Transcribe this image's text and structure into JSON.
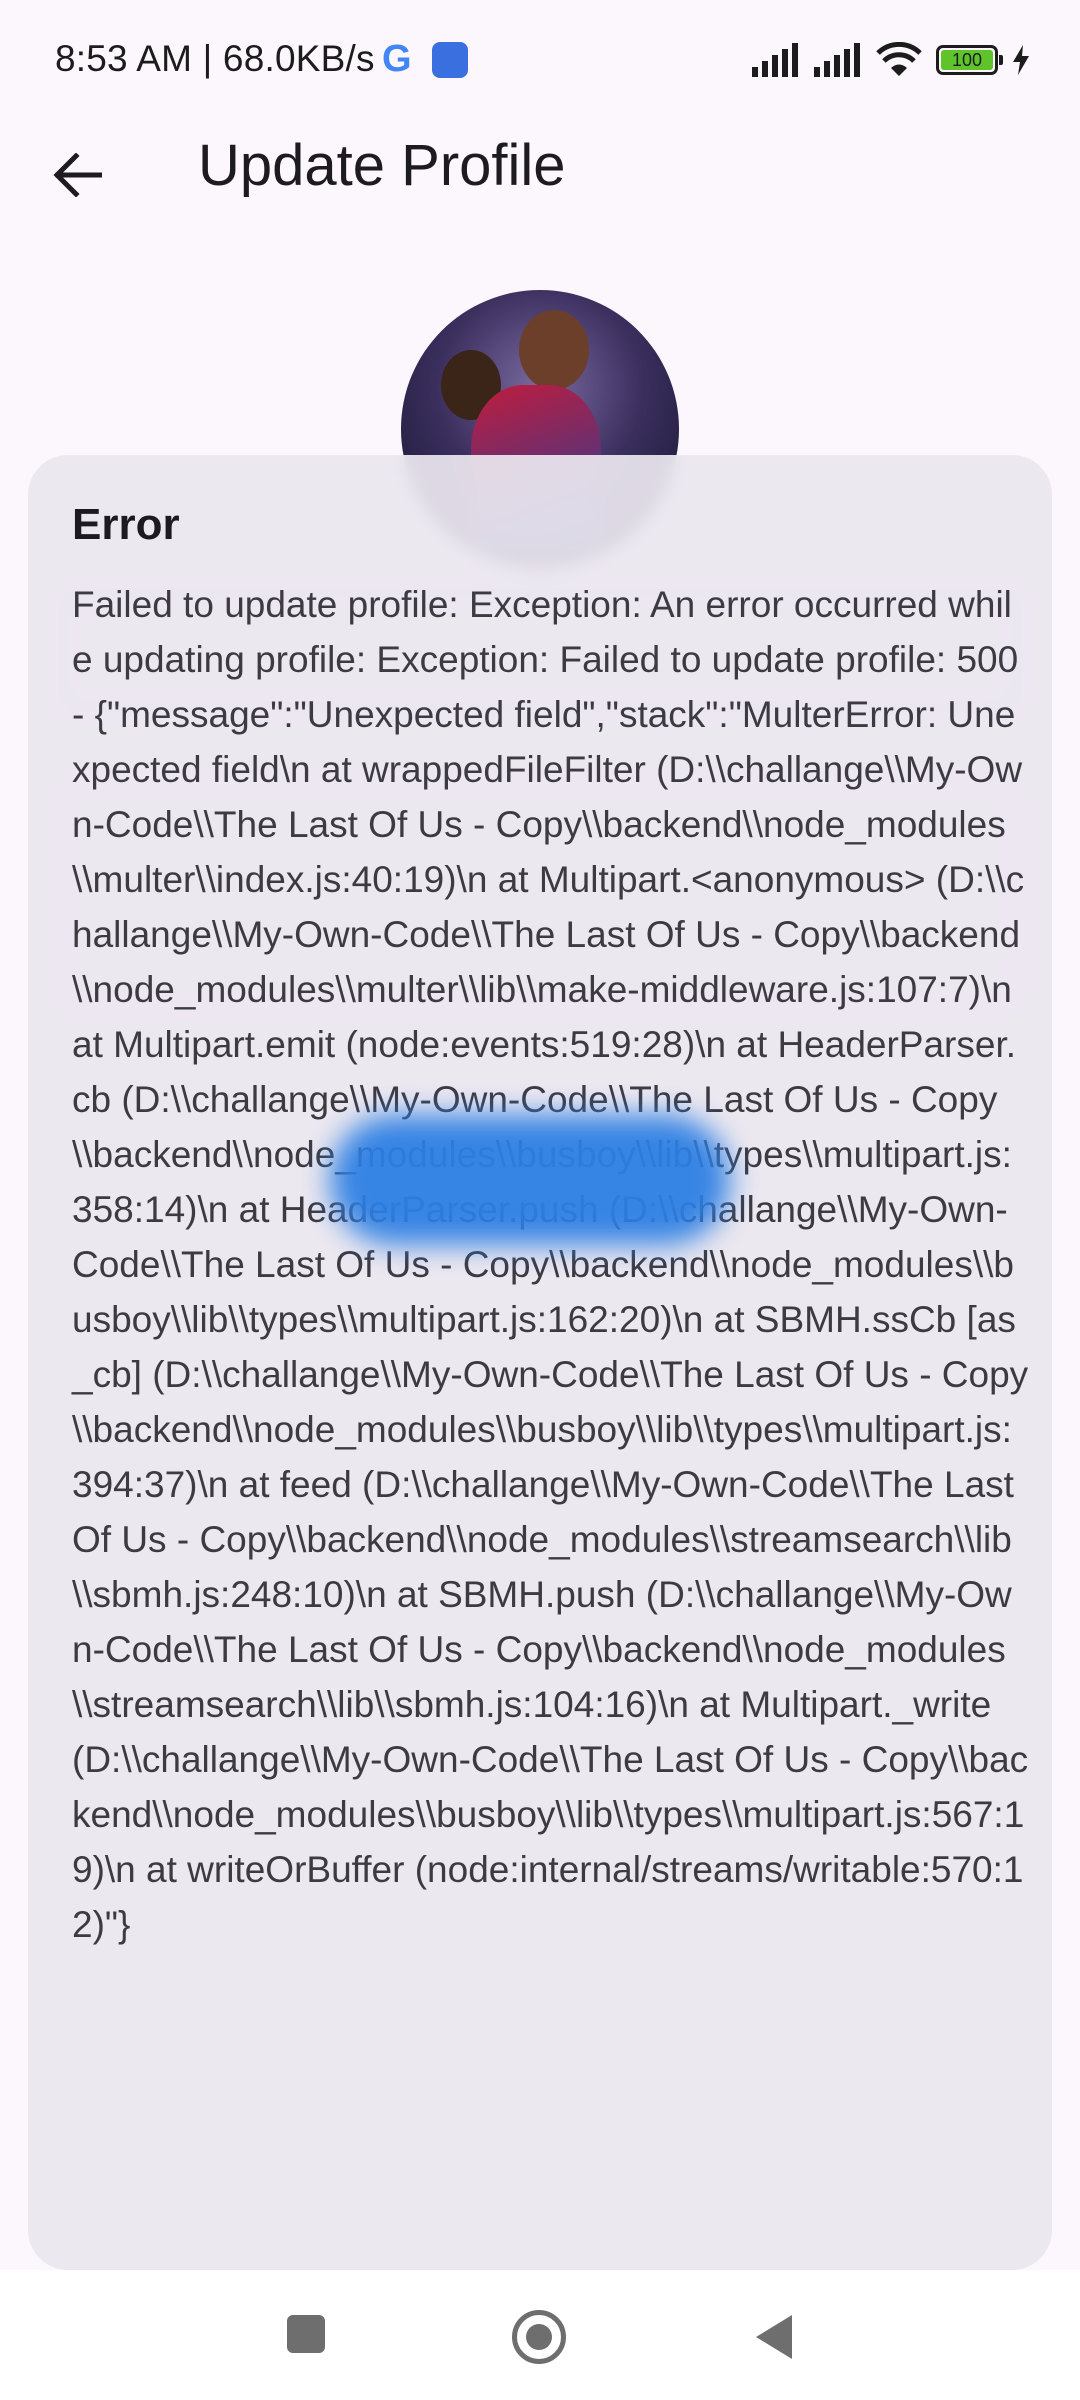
{
  "status_bar": {
    "time_speed": "8:53 AM | 68.0KB/s",
    "google_glyph": "G",
    "battery_level": "100",
    "icons": [
      "google-icon",
      "app-notification-icon",
      "signal-icon",
      "signal-icon",
      "wifi-icon",
      "battery-icon",
      "charging-icon"
    ]
  },
  "app_bar": {
    "title": "Update Profile",
    "back_icon": "arrow-left-icon"
  },
  "dialog": {
    "title": "Error",
    "message": "Failed to update profile: Exception: An error occurred while updating profile: Exception: Failed to update profile: 500 - {\"message\":\"Unexpected field\",\"stack\":\"MulterError: Unexpected field\\n    at wrappedFileFilter (D:\\\\challange\\\\My-Own-Code\\\\The Last Of Us - Copy\\\\backend\\\\node_modules\\\\multer\\\\index.js:40:19)\\n    at Multipart.<anonymous> (D:\\\\challange\\\\My-Own-Code\\\\The Last Of Us - Copy\\\\backend\\\\node_modules\\\\multer\\\\lib\\\\make-middleware.js:107:7)\\n    at Multipart.emit (node:events:519:28)\\n    at HeaderParser.cb (D:\\\\challange\\\\My-Own-Code\\\\The Last Of Us - Copy\\\\backend\\\\node_modules\\\\busboy\\\\lib\\\\types\\\\multipart.js:358:14)\\n    at HeaderParser.push (D:\\\\challange\\\\My-Own-Code\\\\The Last Of Us - Copy\\\\backend\\\\node_modules\\\\busboy\\\\lib\\\\types\\\\multipart.js:162:20)\\n    at SBMH.ssCb [as _cb] (D:\\\\challange\\\\My-Own-Code\\\\The Last Of Us - Copy\\\\backend\\\\node_modules\\\\busboy\\\\lib\\\\types\\\\multipart.js:394:37)\\n    at feed (D:\\\\challange\\\\My-Own-Code\\\\The Last Of Us - Copy\\\\backend\\\\node_modules\\\\streamsearch\\\\lib\\\\sbmh.js:248:10)\\n    at SBMH.push (D:\\\\challange\\\\My-Own-Code\\\\The Last Of Us - Copy\\\\backend\\\\node_modules\\\\streamsearch\\\\lib\\\\sbmh.js:104:16)\\n    at Multipart._write (D:\\\\challange\\\\My-Own-Code\\\\The Last Of Us - Copy\\\\backend\\\\node_modules\\\\busboy\\\\lib\\\\types\\\\multipart.js:567:19)\\n    at writeOrBuffer (node:internal/streams/writable:570:12)\"}"
  },
  "navigation_bar": {
    "icons": [
      "recents-square-icon",
      "home-circle-icon",
      "back-triangle-icon"
    ]
  },
  "colors": {
    "background": "#fcf6fd",
    "dialog": "#ebe6ef",
    "text_primary": "#1d1b20",
    "text_body": "#3d3a42",
    "battery_green": "#5ec42a",
    "blur_blue": "#2d7fe3"
  }
}
